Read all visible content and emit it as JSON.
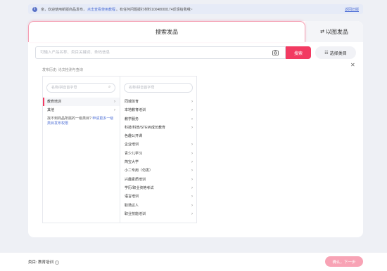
{
  "notice": {
    "prefix": "亲，欢迎使用新版商品发布，",
    "link": "点击查看使用教程",
    "suffix": "。有任何问题拨打材料10048000174反馈给我哦~",
    "close": "返回旧版"
  },
  "tabs": {
    "search": "搜索发品",
    "image": "以图发品"
  },
  "search": {
    "placeholder": "可输入产品名称、类目关键词、条码信息",
    "button": "搜索",
    "choose_category": "选择类目"
  },
  "history": "发布历史: 论文检测与查询",
  "cascade": {
    "left_placeholder": "名称/拼音首字母",
    "right_placeholder": "名称/拼音首字母",
    "left_items": [
      {
        "label": "教育培训",
        "arrow": "›",
        "selected": true
      },
      {
        "label": "其他",
        "arrow": "›",
        "selected": false
      }
    ],
    "missing_text": "找不到商品所属的一级类目?",
    "missing_link": "申请更多一级类目发布权限",
    "right_items": [
      {
        "label": "同城体育",
        "arrow": "›"
      },
      {
        "label": "本地教育培训",
        "arrow": "›"
      },
      {
        "label": "教学服务",
        "arrow": "›"
      },
      {
        "label": "科技/科普/STEM/成长教育",
        "arrow": "›"
      },
      {
        "label": "色趣公开课",
        "arrow": ""
      },
      {
        "label": "企业培训",
        "arrow": "›"
      },
      {
        "label": "青少儿学习",
        "arrow": "›"
      },
      {
        "label": "简宝大学",
        "arrow": "›"
      },
      {
        "label": "小二专用（勿发）",
        "arrow": "›"
      },
      {
        "label": "兴趣素质培训",
        "arrow": "›"
      },
      {
        "label": "学历/职业资格考试",
        "arrow": "›"
      },
      {
        "label": "语言培训",
        "arrow": "›"
      },
      {
        "label": "职场达人",
        "arrow": "›"
      },
      {
        "label": "职业技能培训",
        "arrow": "›"
      }
    ]
  },
  "footer": {
    "category_label": "类目: 教育培训",
    "confirm": "确认，下一步"
  },
  "colors": {
    "accent": "#f23a61",
    "link": "#4e6fd6"
  }
}
